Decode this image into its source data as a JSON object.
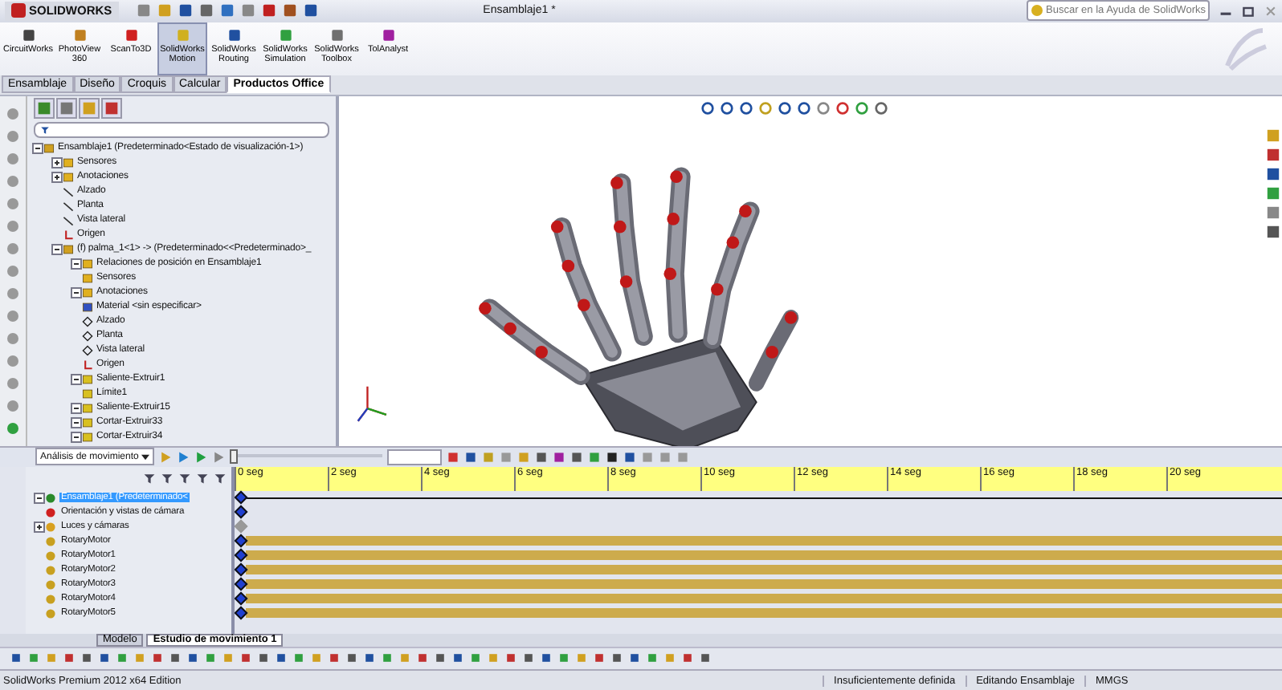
{
  "title_bar": {
    "app": "SOLIDWORKS",
    "document": "Ensamblaje1 *",
    "search": {
      "placeholder": "Buscar en la Ayuda de SolidWorks"
    }
  },
  "ribbon": {
    "buttons": [
      {
        "label": "CircuitWorks",
        "selected": false
      },
      {
        "label": "PhotoView 360",
        "selected": false
      },
      {
        "label": "ScanTo3D",
        "selected": false
      },
      {
        "label": "SolidWorks Motion",
        "selected": true
      },
      {
        "label": "SolidWorks Routing",
        "selected": false
      },
      {
        "label": "SolidWorks Simulation",
        "selected": false
      },
      {
        "label": "SolidWorks Toolbox",
        "selected": false
      },
      {
        "label": "TolAnalyst",
        "selected": false
      }
    ]
  },
  "command_tabs": [
    {
      "label": "Ensamblaje",
      "selected": false
    },
    {
      "label": "Diseño",
      "selected": false
    },
    {
      "label": "Croquis",
      "selected": false
    },
    {
      "label": "Calcular",
      "selected": false
    },
    {
      "label": "Productos Office",
      "selected": true
    }
  ],
  "feature_tree": {
    "items": [
      {
        "label": "Ensamblaje1  (Predeterminado<Estado de visualización-1>)",
        "kind": "assembly",
        "expanded": true,
        "children": [
          {
            "label": "Sensores",
            "kind": "sensor",
            "expanded": false
          },
          {
            "label": "Anotaciones",
            "kind": "annotation",
            "expanded": false
          },
          {
            "label": "Alzado",
            "kind": "plane"
          },
          {
            "label": "Planta",
            "kind": "plane"
          },
          {
            "label": "Vista lateral",
            "kind": "plane"
          },
          {
            "label": "Origen",
            "kind": "origin"
          },
          {
            "label": "(f) palma_1<1> -> (Predeterminado<<Predeterminado>_",
            "kind": "part",
            "expanded": true,
            "children": [
              {
                "label": "Relaciones de posición en Ensamblaje1",
                "kind": "mates",
                "expanded": true
              },
              {
                "label": "Sensores",
                "kind": "sensor"
              },
              {
                "label": "Anotaciones",
                "kind": "annotation",
                "expanded": true
              },
              {
                "label": "Material <sin especificar>",
                "kind": "material"
              },
              {
                "label": "Alzado",
                "kind": "refplane"
              },
              {
                "label": "Planta",
                "kind": "refplane"
              },
              {
                "label": "Vista lateral",
                "kind": "refplane"
              },
              {
                "label": "Origen",
                "kind": "origin"
              },
              {
                "label": "Saliente-Extruir1",
                "kind": "feature",
                "expanded": true
              },
              {
                "label": "Límite1",
                "kind": "boundary"
              },
              {
                "label": "Saliente-Extruir15",
                "kind": "feature",
                "expanded": true
              },
              {
                "label": "Cortar-Extruir33",
                "kind": "feature",
                "expanded": true
              },
              {
                "label": "Cortar-Extruir34",
                "kind": "feature",
                "expanded": true
              }
            ]
          }
        ]
      }
    ]
  },
  "motion_manager": {
    "study_type": "Análisis de movimiento",
    "time_slider": {
      "level": 0
    },
    "ticks": [
      "0 seg",
      "2 seg",
      "4 seg",
      "6 seg",
      "8 seg",
      "10 seg",
      "12 seg",
      "14 seg",
      "16 seg",
      "18 seg",
      "20 seg"
    ],
    "rows": [
      {
        "label": "Ensamblaje1  (Predeterminado<",
        "kind": "assembly",
        "selected": true,
        "expanded": true
      },
      {
        "label": "Orientación y vistas de cámara",
        "kind": "camera",
        "selected": false
      },
      {
        "label": "Luces y cámaras",
        "kind": "lights",
        "selected": false,
        "expanded": false
      },
      {
        "label": "RotaryMotor",
        "kind": "motor",
        "selected": false
      },
      {
        "label": "RotaryMotor1",
        "kind": "motor",
        "selected": false
      },
      {
        "label": "RotaryMotor2",
        "kind": "motor",
        "selected": false
      },
      {
        "label": "RotaryMotor3",
        "kind": "motor",
        "selected": false
      },
      {
        "label": "RotaryMotor4",
        "kind": "motor",
        "selected": false
      },
      {
        "label": "RotaryMotor5",
        "kind": "motor",
        "selected": false
      }
    ]
  },
  "bottom_tabs": [
    {
      "label": "Modelo",
      "selected": false
    },
    {
      "label": "Estudio de movimiento 1",
      "selected": true
    }
  ],
  "status_bar": {
    "product": "SolidWorks Premium 2012 x64 Edition",
    "definition": "Insuficientemente definida",
    "mode": "Editando Ensamblaje",
    "units": "MMGS"
  }
}
